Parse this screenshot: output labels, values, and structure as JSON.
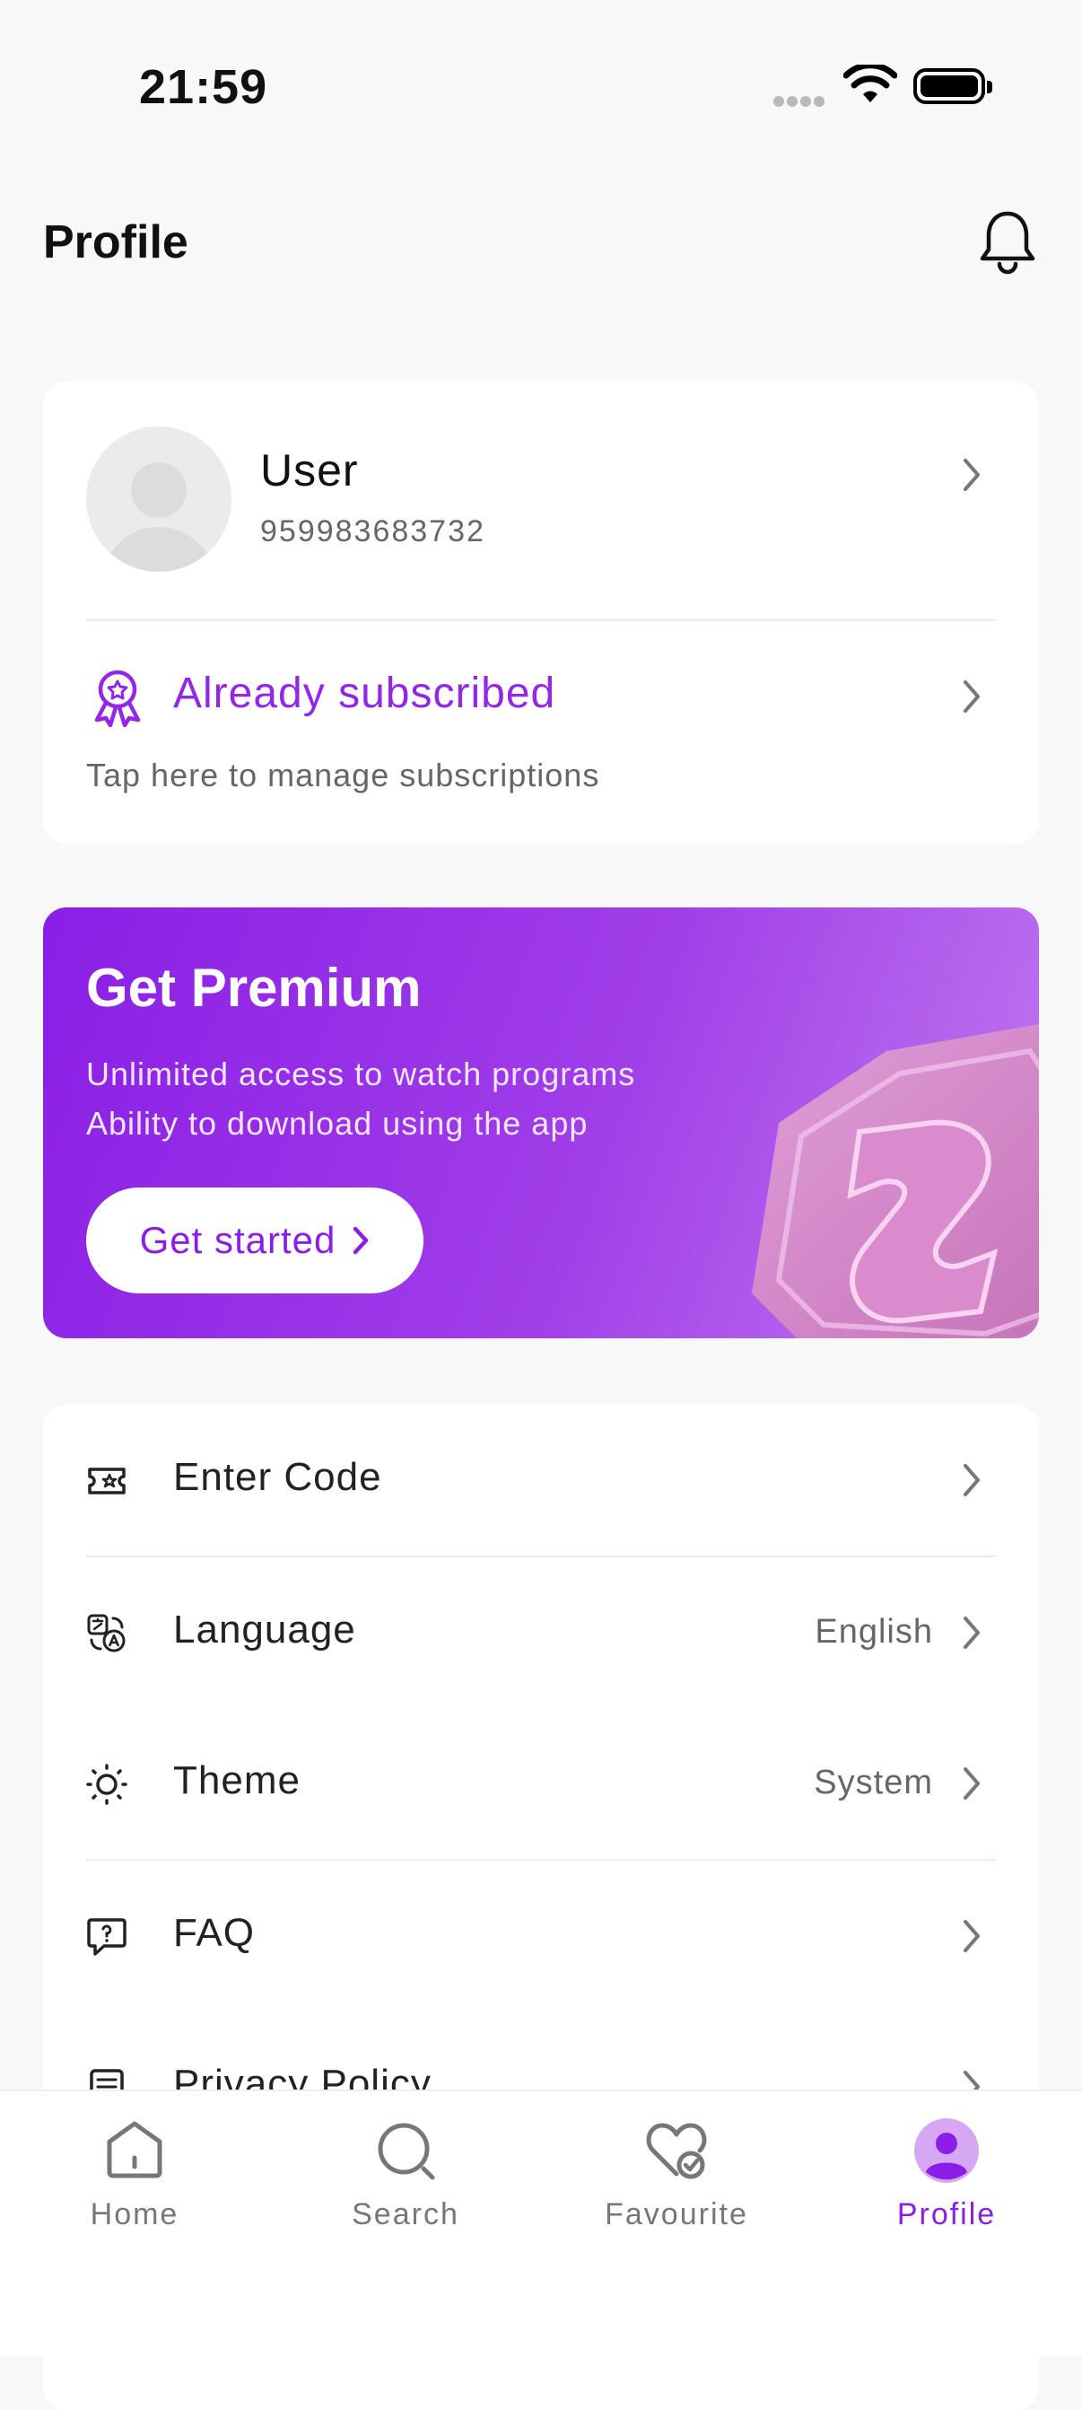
{
  "status": {
    "time": "21:59"
  },
  "header": {
    "title": "Profile"
  },
  "user": {
    "name": "User",
    "phone": "959983683732"
  },
  "subscription": {
    "title": "Already subscribed",
    "description": "Tap here to manage subscriptions"
  },
  "promo": {
    "title": "Get Premium",
    "lines": [
      "Unlimited access to watch programs",
      "Ability to download using the app"
    ],
    "button_label": "Get started"
  },
  "menu": {
    "items": [
      {
        "label": "Enter Code",
        "value": "",
        "icon": "ticket-icon"
      },
      {
        "label": "Language",
        "value": "English",
        "icon": "translate-icon"
      },
      {
        "label": "Theme",
        "value": "System",
        "icon": "sun-icon"
      },
      {
        "label": "FAQ",
        "value": "",
        "icon": "question-bubble-icon"
      },
      {
        "label": "Privacy Policy",
        "value": "",
        "icon": "document-icon"
      }
    ]
  },
  "tabs": [
    {
      "label": "Home",
      "icon": "home-icon"
    },
    {
      "label": "Search",
      "icon": "search-icon"
    },
    {
      "label": "Favourite",
      "icon": "heart-check-icon"
    },
    {
      "label": "Profile",
      "icon": "profile-icon",
      "active": true
    }
  ],
  "colors": {
    "accent": "#8a1ee6",
    "background": "#f8f8f8",
    "card": "#ffffff"
  }
}
